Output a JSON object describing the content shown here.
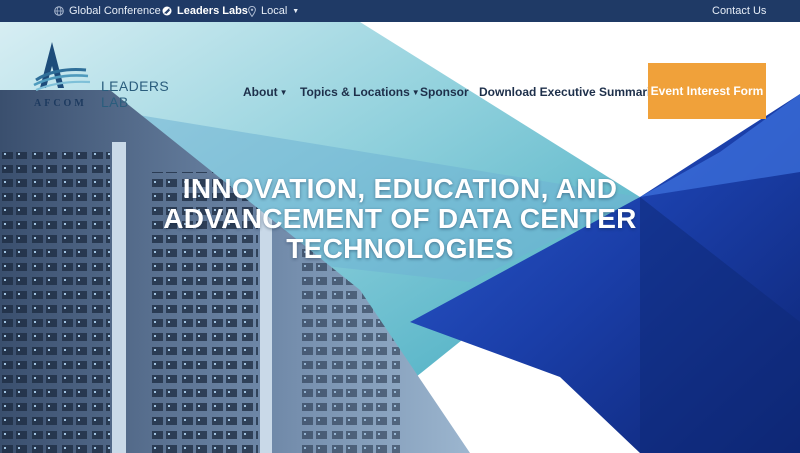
{
  "topbar": {
    "global_conference": "Global Conference",
    "leaders_labs": "Leaders Labs",
    "local": "Local",
    "contact_us": "Contact Us"
  },
  "logo": {
    "wordmark": "AFCOM",
    "subtitle": "LEADERS LAB"
  },
  "nav": {
    "about": "About",
    "topics": "Topics & Locations",
    "sponsor": "Sponsor",
    "download": "Download Executive Summaries",
    "cta": "Event Interest Form"
  },
  "hero": {
    "headline_line1": "INNOVATION, EDUCATION, AND",
    "headline_line2": "ADVANCEMENT OF DATA CENTER",
    "headline_line3": "TECHNOLOGIES"
  },
  "colors": {
    "topbar": "#1f3a66",
    "cta": "#f0a13a",
    "nav_text": "#1d2f4a"
  }
}
